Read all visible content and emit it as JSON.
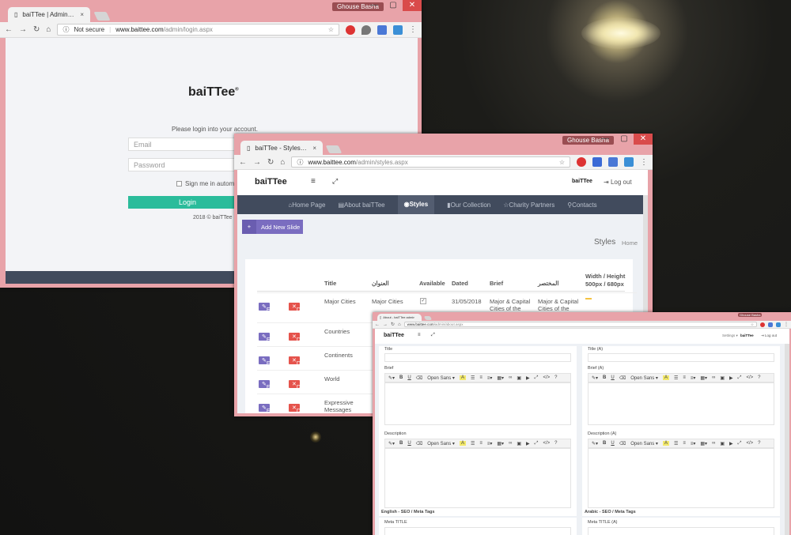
{
  "login_window": {
    "tab_title": "baiTTee | Admin Login S",
    "user": "Ghouse Basha",
    "url_status": "Not secure",
    "url_host": "www.baittee.com",
    "url_path": "/admin/login.aspx",
    "logo": "baiTTee",
    "logo_mark": "®",
    "prompt": "Please login into your account.",
    "email_placeholder": "Email",
    "password_placeholder": "Password",
    "remember_label": "Sign me in automat",
    "login_button": "Login",
    "footer": "2018 © baiTTee"
  },
  "styles_window": {
    "tab_title": "baiTTee - Styles - Manag",
    "user": "Ghouse Basha",
    "url_host": "www.baittee.com",
    "url_path": "/admin/styles.aspx",
    "brand": "baiTTee",
    "logo_small": "baiTTee",
    "logout": "Log out",
    "nav": [
      "Home Page",
      "About baiTTee",
      "Styles",
      "Our Collection",
      "Charity Partners",
      "Contacts"
    ],
    "add_button": "Add New Slide",
    "page_title": "Styles",
    "breadcrumb_home": "Home",
    "columns": {
      "title": "Title",
      "title_ar": "العنوان",
      "available": "Available",
      "dated": "Dated",
      "brief": "Brief",
      "brief_ar": "المختصر",
      "size_line1": "Width / Height",
      "size_line2": "500px / 680px"
    },
    "edit_label": "Edit",
    "delete_label": "Delete",
    "rows": [
      {
        "title": "Major Cities",
        "title_ar": "Major Cities",
        "dated": "31/05/2018",
        "brief": "Major & Capital Cities of the",
        "brief_ar": "Major & Capital Cities of the",
        "pic": "Styles Pic"
      },
      {
        "title": "Countries"
      },
      {
        "title": "Continents"
      },
      {
        "title": "World"
      },
      {
        "title": "Expressive Messages"
      }
    ]
  },
  "about_window": {
    "tab_title": "About - baiTTee admin",
    "user": "Ghouse Basha",
    "url_host": "www.baittee.com",
    "url_path": "/admin/about.aspx",
    "brand": "baiTTee",
    "settings": "Settings",
    "logo_small": "baiTTee",
    "logout": "Log out",
    "left": {
      "title": "Title",
      "brief": "Brief",
      "description": "Description",
      "seo": "English - SEO / Meta Tags",
      "meta": "Meta TITLE"
    },
    "right": {
      "title": "Title (A)",
      "brief": "Brief (A)",
      "description": "Description (A)",
      "seo": "Arabic - SEO / Meta Tags",
      "meta": "Meta TITLE (A)"
    },
    "font_name": "Open Sans"
  },
  "colors": {
    "titlebar": "#e8a3a9",
    "nav": "#414b5d",
    "accent_green": "#2bbc9b",
    "accent_purple": "#7a6dc0",
    "delete_red": "#e5534c",
    "pic_yellow": "#f5c342"
  }
}
